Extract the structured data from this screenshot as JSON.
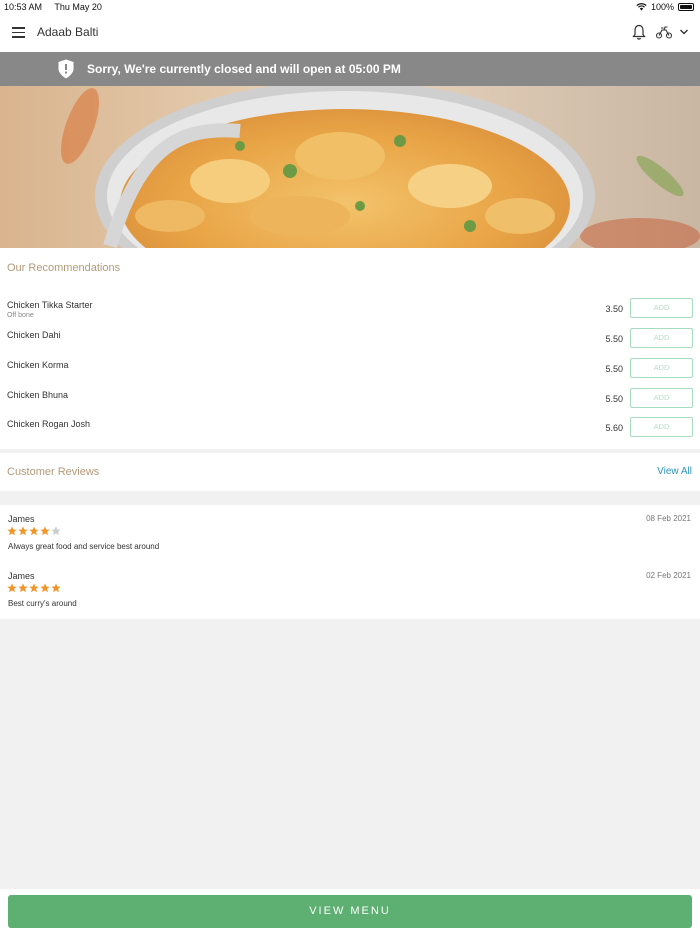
{
  "status_bar": {
    "time": "10:53 AM",
    "date": "Thu May 20",
    "battery": "100%"
  },
  "header": {
    "title": "Adaab Balti"
  },
  "closed_banner": {
    "text": "Sorry, We're currently closed and will open at 05:00 PM"
  },
  "recommendations": {
    "title": "Our Recommendations",
    "add_label": "ADD",
    "items": [
      {
        "name": "Chicken Tikka Starter",
        "desc": "Off bone",
        "price": "3.50"
      },
      {
        "name": "Chicken Dahi",
        "desc": "",
        "price": "5.50"
      },
      {
        "name": "Chicken Korma",
        "desc": "",
        "price": "5.50"
      },
      {
        "name": "Chicken Bhuna",
        "desc": "",
        "price": "5.50"
      },
      {
        "name": "Chicken Rogan Josh",
        "desc": "",
        "price": "5.60"
      }
    ]
  },
  "reviews": {
    "title": "Customer Reviews",
    "view_all": "View All",
    "items": [
      {
        "name": "James",
        "date": "08 Feb 2021",
        "rating": 4,
        "text": "Always great food and service best around"
      },
      {
        "name": "James",
        "date": "02 Feb 2021",
        "rating": 5,
        "text": "Best curry's around"
      }
    ]
  },
  "footer": {
    "view_menu": "VIEW MENU"
  },
  "colors": {
    "accent_green": "#5daf72",
    "star": "#f0952a",
    "link": "#2b93ba",
    "section_title": "#b39a78",
    "banner": "#888888"
  }
}
